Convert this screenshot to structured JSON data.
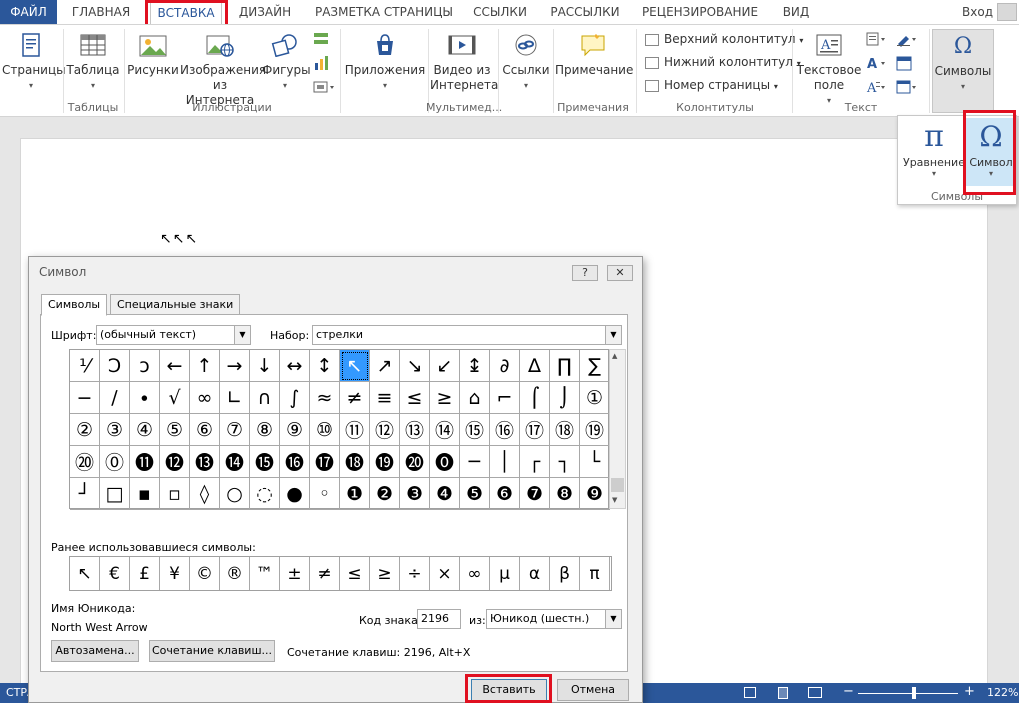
{
  "ribbon_tabs": {
    "file": "ФАЙЛ",
    "home": "ГЛАВНАЯ",
    "insert": "ВСТАВКА",
    "design": "ДИЗАЙН",
    "layout": "РАЗМЕТКА СТРАНИЦЫ",
    "references": "ССЫЛКИ",
    "mailings": "РАССЫЛКИ",
    "review": "РЕЦЕНЗИРОВАНИЕ",
    "view": "ВИД",
    "login": "Вход"
  },
  "ribbon": {
    "pages": "Страницы",
    "table": "Таблица",
    "pictures": "Рисунки",
    "online_line1": "Изображения",
    "online_line2": "из Интернета",
    "shapes": "Фигуры",
    "apps": "Приложения",
    "video_line1": "Видео из",
    "video_line2": "Интернета",
    "links": "Ссылки",
    "comment": "Примечание",
    "header": "Верхний колонтитул",
    "footer": "Нижний колонтитул",
    "page_number": "Номер страницы",
    "textbox_line1": "Текстовое",
    "textbox_line2": "поле",
    "symbols": "Символы",
    "groups": {
      "tables": "Таблицы",
      "illustrations": "Иллюстрации",
      "multimedia": "Мультимед...",
      "comments": "Примечания",
      "header_footer": "Колонтитулы",
      "text": "Текст"
    }
  },
  "symbols_popup": {
    "equation": "Уравнение",
    "symbol": "Символ",
    "group": "Символы",
    "pi_glyph": "π",
    "omega_glyph": "Ω"
  },
  "document": {
    "text": "↖↖↖"
  },
  "status_bar": {
    "page": "СТРА",
    "zoom": "122%"
  },
  "dialog": {
    "title": "Символ",
    "help": "?",
    "close": "✕",
    "tab_symbols": "Символы",
    "tab_special": "Специальные знаки",
    "font_label": "Шрифт:",
    "font_value": "(обычный текст)",
    "subset_label": "Набор:",
    "subset_value": "стрелки",
    "grid": [
      [
        "⅟",
        "Ↄ",
        "ↄ",
        "←",
        "↑",
        "→",
        "↓",
        "↔",
        "↕",
        "↖",
        "↗",
        "↘",
        "↙",
        "↨",
        "∂",
        "∆",
        "∏",
        "∑"
      ],
      [
        "−",
        "∕",
        "∙",
        "√",
        "∞",
        "∟",
        "∩",
        "∫",
        "≈",
        "≠",
        "≡",
        "≤",
        "≥",
        "⌂",
        "⌐",
        "⌠",
        "⌡",
        "①"
      ],
      [
        "②",
        "③",
        "④",
        "⑤",
        "⑥",
        "⑦",
        "⑧",
        "⑨",
        "⑩",
        "⑪",
        "⑫",
        "⑬",
        "⑭",
        "⑮",
        "⑯",
        "⑰",
        "⑱",
        "⑲"
      ],
      [
        "⑳",
        "⓪",
        "⓫",
        "⓬",
        "⓭",
        "⓮",
        "⓯",
        "⓰",
        "⓱",
        "⓲",
        "⓳",
        "⓴",
        "⓿",
        "─",
        "│",
        "┌",
        "┐",
        "└"
      ],
      [
        "┘",
        "□",
        "▪",
        "▫",
        "◊",
        "○",
        "◌",
        "●",
        "◦",
        "❶",
        "❷",
        "❸",
        "❹",
        "❺",
        "❻",
        "❼",
        "❽",
        "❾"
      ]
    ],
    "recent_label": "Ранее использовавшиеся символы:",
    "recent": [
      "↖",
      "€",
      "£",
      "¥",
      "©",
      "®",
      "™",
      "±",
      "≠",
      "≤",
      "≥",
      "÷",
      "×",
      "∞",
      "µ",
      "α",
      "β",
      "π"
    ],
    "unicode_name_label": "Имя Юникода:",
    "unicode_name": "North West Arrow",
    "code_label": "Код знака:",
    "code_value": "2196",
    "from_label": "из:",
    "from_value": "Юникод (шестн.)",
    "autocorrect_button": "Автозамена...",
    "shortcut_button": "Сочетание клавиш...",
    "shortcut_text": "Сочетание клавиш: 2196, Alt+X",
    "insert_button": "Вставить",
    "cancel_button": "Отмена"
  },
  "colors": {
    "accent": "#2b579a",
    "highlight": "#e01020",
    "selection": "#3399ff"
  }
}
